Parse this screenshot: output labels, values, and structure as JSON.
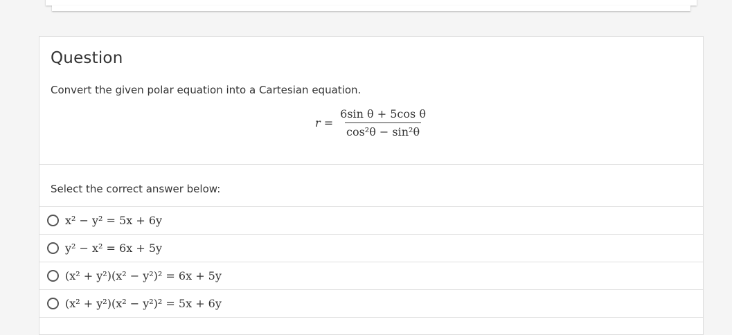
{
  "question": {
    "title": "Question",
    "prompt": "Convert the given polar equation into a Cartesian equation.",
    "equation": {
      "lhs": "r =",
      "numerator": "6sin θ + 5cos θ",
      "denominator": "cos²θ − sin²θ"
    }
  },
  "answers": {
    "label": "Select the correct answer below:",
    "options": [
      {
        "text": "x² − y² = 5x + 6y"
      },
      {
        "text": "y² − x² = 6x + 5y"
      },
      {
        "text": "(x² + y²)(x² − y²)² = 6x + 5y"
      },
      {
        "text": "(x² + y²)(x² − y²)² = 5x + 6y"
      }
    ]
  }
}
